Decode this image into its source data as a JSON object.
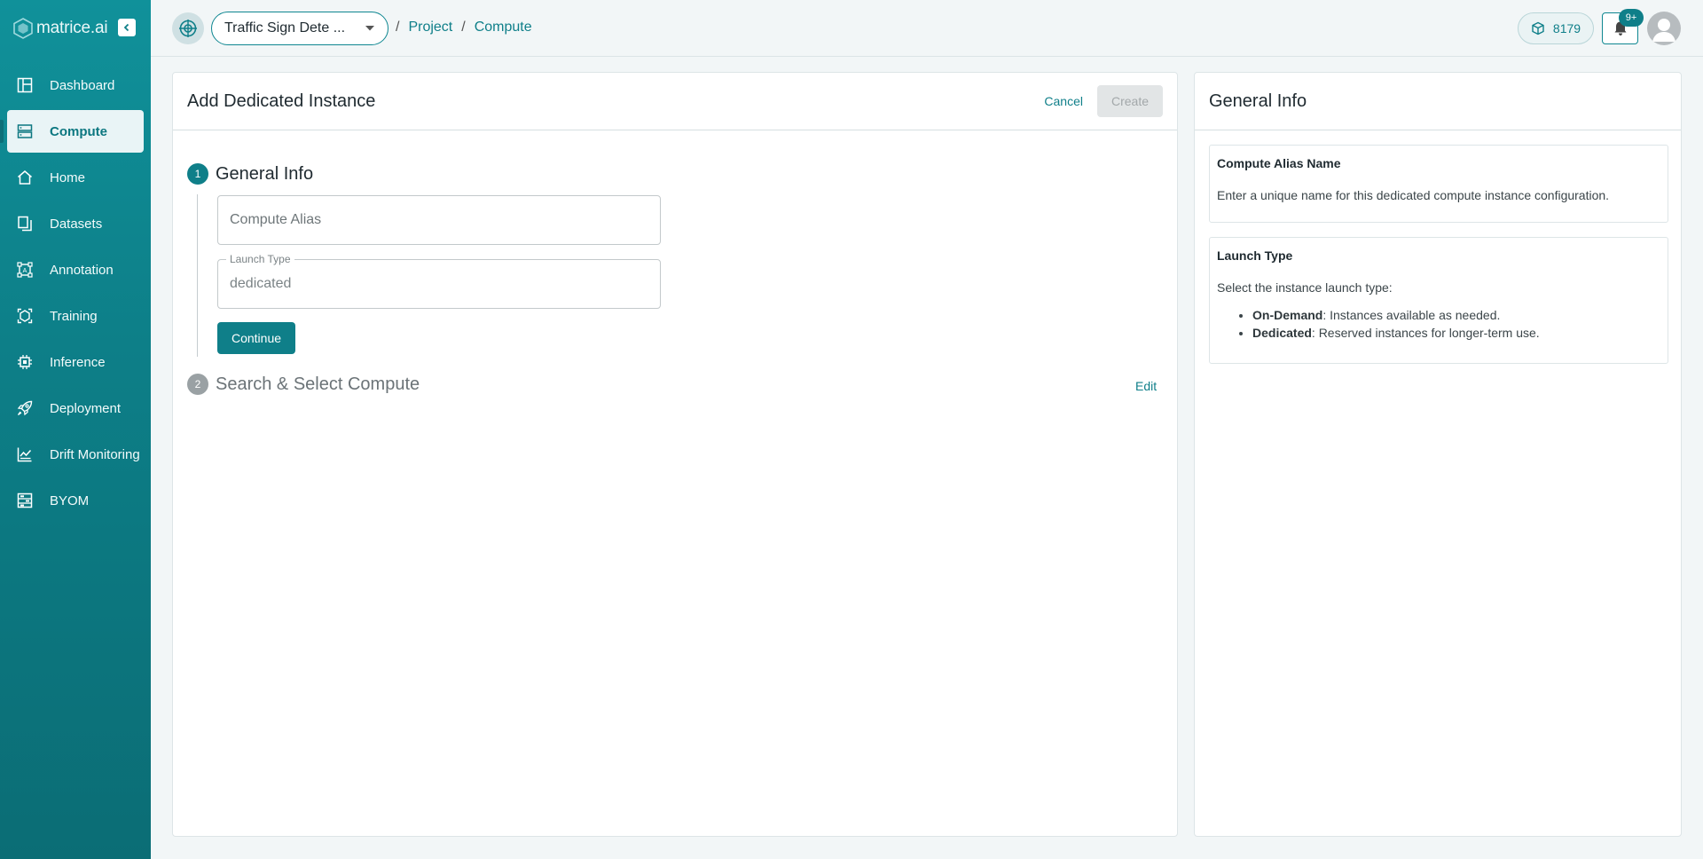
{
  "brand": {
    "name": "matrice.ai"
  },
  "sidebar": {
    "items": [
      {
        "label": "Dashboard",
        "icon": "dashboard-icon",
        "active": false
      },
      {
        "label": "Compute",
        "icon": "compute-icon",
        "active": true
      },
      {
        "label": "Home",
        "icon": "home-icon",
        "active": false
      },
      {
        "label": "Datasets",
        "icon": "datasets-icon",
        "active": false
      },
      {
        "label": "Annotation",
        "icon": "annotation-icon",
        "active": false
      },
      {
        "label": "Training",
        "icon": "training-icon",
        "active": false
      },
      {
        "label": "Inference",
        "icon": "inference-icon",
        "active": false
      },
      {
        "label": "Deployment",
        "icon": "deployment-icon",
        "active": false
      },
      {
        "label": "Drift Monitoring",
        "icon": "drift-monitoring-icon",
        "active": false
      },
      {
        "label": "BYOM",
        "icon": "byom-icon",
        "active": false
      }
    ]
  },
  "header": {
    "project_name": "Traffic Sign Dete ...",
    "breadcrumb": [
      "Project",
      "Compute"
    ],
    "credits": "8179",
    "notifications_badge": "9+"
  },
  "main": {
    "title": "Add Dedicated Instance",
    "cancel_label": "Cancel",
    "create_label": "Create",
    "step1": {
      "number": "1",
      "title": "General Info",
      "alias_placeholder": "Compute Alias",
      "launch_type_label": "Launch Type",
      "launch_type_value": "dedicated",
      "continue_label": "Continue"
    },
    "step2": {
      "number": "2",
      "title": "Search & Select Compute",
      "edit_label": "Edit"
    }
  },
  "side": {
    "title": "General Info",
    "alias_box": {
      "title": "Compute Alias Name",
      "text": "Enter a unique name for this dedicated compute instance configuration."
    },
    "launch_box": {
      "title": "Launch Type",
      "text": "Select the instance launch type:",
      "options": [
        {
          "term": "On-Demand",
          "desc": ": Instances available as needed."
        },
        {
          "term": "Dedicated",
          "desc": ": Reserved instances for longer-term use."
        }
      ]
    }
  },
  "colors": {
    "accent": "#0f7f89",
    "sidebar": "#0d7f88",
    "background": "#f2f6f7"
  }
}
